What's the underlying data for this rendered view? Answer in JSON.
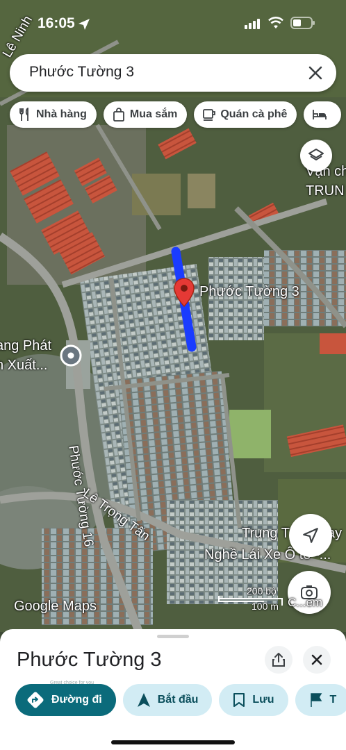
{
  "status": {
    "time": "16:05"
  },
  "search": {
    "query": "Phước Tường 3"
  },
  "chips": [
    {
      "label": "Nhà hàng",
      "icon": "restaurant-icon"
    },
    {
      "label": "Mua sắm",
      "icon": "shopping-bag-icon"
    },
    {
      "label": "Quán cà phê",
      "icon": "coffee-icon"
    },
    {
      "label": "",
      "icon": "hotel-icon"
    }
  ],
  "map": {
    "pin_label": "Phước Tường 3",
    "street_1": "Phước Tường 16",
    "street_2": "Lê Trọng Tấn",
    "street_3": "Lê Ninh",
    "place_1a": "ang Phát",
    "place_1b": "n Xuất...",
    "place_2a": "Trung T",
    "place_2b": "ạy",
    "place_2c": "Nghề Lái Xe Ô tô -...",
    "place_3a": "Vận ch",
    "place_3b": "TRUN",
    "attribution": "Google Maps",
    "scale_ft": "200 bộ",
    "scale_m": "100 m",
    "lens_label": "C...em",
    "road_color": "#1a3cff",
    "pin_color": "#e53935"
  },
  "sheet": {
    "title": "Phước Tường 3",
    "ad_text": "Great choice for you",
    "actions": [
      {
        "label": "Đường đi"
      },
      {
        "label": "Bắt đầu"
      },
      {
        "label": "Lưu"
      },
      {
        "label": "T"
      }
    ]
  }
}
